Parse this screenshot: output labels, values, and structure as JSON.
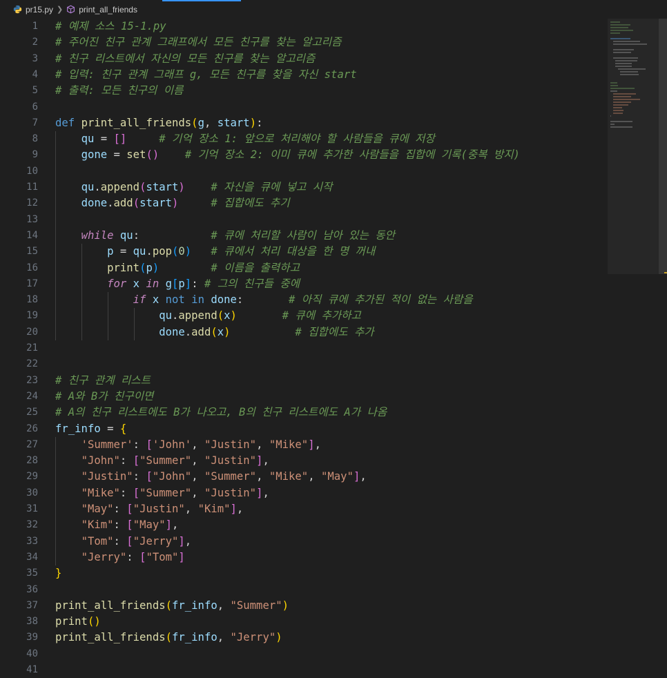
{
  "breadcrumb": {
    "file": "pr15.py",
    "symbol": "print_all_friends"
  },
  "icons": {
    "file": "python-icon",
    "symbol": "method-cube-icon"
  },
  "theme": {
    "background": "#1f1f1f",
    "comment": "#6a9955",
    "keyword": "#569cd6",
    "string": "#ce9178",
    "function": "#dcdcaa"
  },
  "lines": [
    {
      "n": "1",
      "tokens": [
        [
          "cm",
          "# 예제 소스 15-1.py"
        ]
      ]
    },
    {
      "n": "2",
      "tokens": [
        [
          "cm",
          "# 주어진 친구 관계 그래프에서 모든 친구를 찾는 알고리즘"
        ]
      ]
    },
    {
      "n": "3",
      "tokens": [
        [
          "cm",
          "# 친구 리스트에서 자신의 모든 친구를 찾는 알고리즘"
        ]
      ]
    },
    {
      "n": "4",
      "tokens": [
        [
          "cm",
          "# 입력: 친구 관계 그래프 g, 모든 친구를 찾을 자신 start"
        ]
      ]
    },
    {
      "n": "5",
      "tokens": [
        [
          "cm",
          "# 출력: 모든 친구의 이름"
        ]
      ]
    },
    {
      "n": "6",
      "tokens": []
    },
    {
      "n": "7",
      "tokens": [
        [
          "kw",
          "def "
        ],
        [
          "fn",
          "print_all_friends"
        ],
        [
          "b1",
          "("
        ],
        [
          "prm",
          "g"
        ],
        [
          "op",
          ", "
        ],
        [
          "prm",
          "start"
        ],
        [
          "b1",
          ")"
        ],
        [
          "op",
          ":"
        ]
      ]
    },
    {
      "n": "8",
      "tokens": [
        [
          "plain",
          "    "
        ],
        [
          "var",
          "qu"
        ],
        [
          "op",
          " = "
        ],
        [
          "b2",
          "[]"
        ],
        [
          "plain",
          "     "
        ],
        [
          "cm",
          "# 기억 장소 1: 앞으로 처리해야 할 사람들을 큐에 저장"
        ]
      ]
    },
    {
      "n": "9",
      "tokens": [
        [
          "plain",
          "    "
        ],
        [
          "var",
          "gone"
        ],
        [
          "op",
          " = "
        ],
        [
          "fn",
          "set"
        ],
        [
          "b2",
          "()"
        ],
        [
          "plain",
          "    "
        ],
        [
          "cm",
          "# 기억 장소 2: 이미 큐에 추가한 사람들을 집합에 기록(중복 방지)"
        ]
      ]
    },
    {
      "n": "10",
      "tokens": []
    },
    {
      "n": "11",
      "tokens": [
        [
          "plain",
          "    "
        ],
        [
          "var",
          "qu"
        ],
        [
          "op",
          "."
        ],
        [
          "fn",
          "append"
        ],
        [
          "b2",
          "("
        ],
        [
          "var",
          "start"
        ],
        [
          "b2",
          ")"
        ],
        [
          "plain",
          "    "
        ],
        [
          "cm",
          "# 자신을 큐에 넣고 시작"
        ]
      ]
    },
    {
      "n": "12",
      "tokens": [
        [
          "plain",
          "    "
        ],
        [
          "var",
          "done"
        ],
        [
          "op",
          "."
        ],
        [
          "fn",
          "add"
        ],
        [
          "b2",
          "("
        ],
        [
          "var",
          "start"
        ],
        [
          "b2",
          ")"
        ],
        [
          "plain",
          "     "
        ],
        [
          "cm",
          "# 집합에도 추기"
        ]
      ]
    },
    {
      "n": "13",
      "tokens": []
    },
    {
      "n": "14",
      "tokens": [
        [
          "plain",
          "    "
        ],
        [
          "ctl-i",
          "while "
        ],
        [
          "var",
          "qu"
        ],
        [
          "op",
          ":"
        ],
        [
          "plain",
          "           "
        ],
        [
          "cm",
          "# 큐에 처리할 사람이 남아 있는 동안"
        ]
      ]
    },
    {
      "n": "15",
      "tokens": [
        [
          "plain",
          "        "
        ],
        [
          "var",
          "p"
        ],
        [
          "op",
          " = "
        ],
        [
          "var",
          "qu"
        ],
        [
          "op",
          "."
        ],
        [
          "fn",
          "pop"
        ],
        [
          "b3",
          "("
        ],
        [
          "num",
          "0"
        ],
        [
          "b3",
          ")"
        ],
        [
          "plain",
          "   "
        ],
        [
          "cm",
          "# 큐에서 처리 대상을 한 명 꺼내"
        ]
      ]
    },
    {
      "n": "16",
      "tokens": [
        [
          "plain",
          "        "
        ],
        [
          "fn",
          "print"
        ],
        [
          "b3",
          "("
        ],
        [
          "var",
          "p"
        ],
        [
          "b3",
          ")"
        ],
        [
          "plain",
          "        "
        ],
        [
          "cm",
          "# 이름을 출력하고"
        ]
      ]
    },
    {
      "n": "17",
      "tokens": [
        [
          "plain",
          "        "
        ],
        [
          "ctl-i",
          "for "
        ],
        [
          "var",
          "x"
        ],
        [
          "ctl-i",
          " in "
        ],
        [
          "var",
          "g"
        ],
        [
          "b3",
          "["
        ],
        [
          "var",
          "p"
        ],
        [
          "b3",
          "]"
        ],
        [
          "op",
          ":"
        ],
        [
          "plain",
          " "
        ],
        [
          "cm",
          "# 그의 친구들 중에"
        ]
      ]
    },
    {
      "n": "18",
      "tokens": [
        [
          "plain",
          "            "
        ],
        [
          "ctl-i",
          "if "
        ],
        [
          "var",
          "x"
        ],
        [
          "kw",
          " not in "
        ],
        [
          "var",
          "done"
        ],
        [
          "op",
          ":"
        ],
        [
          "plain",
          "       "
        ],
        [
          "cm",
          "# 아직 큐에 추가된 적이 없는 사람을"
        ]
      ]
    },
    {
      "n": "19",
      "tokens": [
        [
          "plain",
          "                "
        ],
        [
          "var",
          "qu"
        ],
        [
          "op",
          "."
        ],
        [
          "fn",
          "append"
        ],
        [
          "b1",
          "("
        ],
        [
          "var",
          "x"
        ],
        [
          "b1",
          ")"
        ],
        [
          "plain",
          "       "
        ],
        [
          "cm",
          "# 큐에 추가하고"
        ]
      ]
    },
    {
      "n": "20",
      "tokens": [
        [
          "plain",
          "                "
        ],
        [
          "var",
          "done"
        ],
        [
          "op",
          "."
        ],
        [
          "fn",
          "add"
        ],
        [
          "b1",
          "("
        ],
        [
          "var",
          "x"
        ],
        [
          "b1",
          ")"
        ],
        [
          "plain",
          "          "
        ],
        [
          "cm",
          "# 집합에도 추가"
        ]
      ]
    },
    {
      "n": "21",
      "tokens": []
    },
    {
      "n": "22",
      "tokens": []
    },
    {
      "n": "23",
      "tokens": [
        [
          "cm",
          "# 친구 관계 리스트"
        ]
      ]
    },
    {
      "n": "24",
      "tokens": [
        [
          "cm",
          "# A와 B가 친구이면"
        ]
      ]
    },
    {
      "n": "25",
      "tokens": [
        [
          "cm",
          "# A의 친구 리스트에도 B가 나오고, B의 친구 리스트에도 A가 나옴"
        ]
      ]
    },
    {
      "n": "26",
      "tokens": [
        [
          "var",
          "fr_info"
        ],
        [
          "op",
          " = "
        ],
        [
          "b1",
          "{"
        ]
      ]
    },
    {
      "n": "27",
      "tokens": [
        [
          "plain",
          "    "
        ],
        [
          "str",
          "'Summer'"
        ],
        [
          "op",
          ": "
        ],
        [
          "b2",
          "["
        ],
        [
          "str",
          "'John'"
        ],
        [
          "op",
          ", "
        ],
        [
          "str",
          "\"Justin\""
        ],
        [
          "op",
          ", "
        ],
        [
          "str",
          "\"Mike\""
        ],
        [
          "b2",
          "]"
        ],
        [
          "op",
          ","
        ]
      ]
    },
    {
      "n": "28",
      "tokens": [
        [
          "plain",
          "    "
        ],
        [
          "str",
          "\"John\""
        ],
        [
          "op",
          ": "
        ],
        [
          "b2",
          "["
        ],
        [
          "str",
          "\"Summer\""
        ],
        [
          "op",
          ", "
        ],
        [
          "str",
          "\"Justin\""
        ],
        [
          "b2",
          "]"
        ],
        [
          "op",
          ","
        ]
      ]
    },
    {
      "n": "29",
      "tokens": [
        [
          "plain",
          "    "
        ],
        [
          "str",
          "\"Justin\""
        ],
        [
          "op",
          ": "
        ],
        [
          "b2",
          "["
        ],
        [
          "str",
          "\"John\""
        ],
        [
          "op",
          ", "
        ],
        [
          "str",
          "\"Summer\""
        ],
        [
          "op",
          ", "
        ],
        [
          "str",
          "\"Mike\""
        ],
        [
          "op",
          ", "
        ],
        [
          "str",
          "\"May\""
        ],
        [
          "b2",
          "]"
        ],
        [
          "op",
          ","
        ]
      ]
    },
    {
      "n": "30",
      "tokens": [
        [
          "plain",
          "    "
        ],
        [
          "str",
          "\"Mike\""
        ],
        [
          "op",
          ": "
        ],
        [
          "b2",
          "["
        ],
        [
          "str",
          "\"Summer\""
        ],
        [
          "op",
          ", "
        ],
        [
          "str",
          "\"Justin\""
        ],
        [
          "b2",
          "]"
        ],
        [
          "op",
          ","
        ]
      ]
    },
    {
      "n": "31",
      "tokens": [
        [
          "plain",
          "    "
        ],
        [
          "str",
          "\"May\""
        ],
        [
          "op",
          ": "
        ],
        [
          "b2",
          "["
        ],
        [
          "str",
          "\"Justin\""
        ],
        [
          "op",
          ", "
        ],
        [
          "str",
          "\"Kim\""
        ],
        [
          "b2",
          "]"
        ],
        [
          "op",
          ","
        ]
      ]
    },
    {
      "n": "32",
      "tokens": [
        [
          "plain",
          "    "
        ],
        [
          "str",
          "\"Kim\""
        ],
        [
          "op",
          ": "
        ],
        [
          "b2",
          "["
        ],
        [
          "str",
          "\"May\""
        ],
        [
          "b2",
          "]"
        ],
        [
          "op",
          ","
        ]
      ]
    },
    {
      "n": "33",
      "tokens": [
        [
          "plain",
          "    "
        ],
        [
          "str",
          "\"Tom\""
        ],
        [
          "op",
          ": "
        ],
        [
          "b2",
          "["
        ],
        [
          "str",
          "\"Jerry\""
        ],
        [
          "b2",
          "]"
        ],
        [
          "op",
          ","
        ]
      ]
    },
    {
      "n": "34",
      "tokens": [
        [
          "plain",
          "    "
        ],
        [
          "str",
          "\"Jerry\""
        ],
        [
          "op",
          ": "
        ],
        [
          "b2",
          "["
        ],
        [
          "str",
          "\"Tom\""
        ],
        [
          "b2",
          "]"
        ]
      ]
    },
    {
      "n": "35",
      "tokens": [
        [
          "b1",
          "}"
        ]
      ]
    },
    {
      "n": "36",
      "tokens": []
    },
    {
      "n": "37",
      "tokens": [
        [
          "fn",
          "print_all_friends"
        ],
        [
          "b1",
          "("
        ],
        [
          "var",
          "fr_info"
        ],
        [
          "op",
          ", "
        ],
        [
          "str",
          "\"Summer\""
        ],
        [
          "b1",
          ")"
        ]
      ]
    },
    {
      "n": "38",
      "tokens": [
        [
          "fn",
          "print"
        ],
        [
          "b1",
          "()"
        ]
      ]
    },
    {
      "n": "39",
      "tokens": [
        [
          "fn",
          "print_all_friends"
        ],
        [
          "b1",
          "("
        ],
        [
          "var",
          "fr_info"
        ],
        [
          "op",
          ", "
        ],
        [
          "str",
          "\"Jerry\""
        ],
        [
          "b1",
          ")"
        ]
      ]
    },
    {
      "n": "40",
      "tokens": []
    },
    {
      "n": "41",
      "tokens": []
    }
  ]
}
